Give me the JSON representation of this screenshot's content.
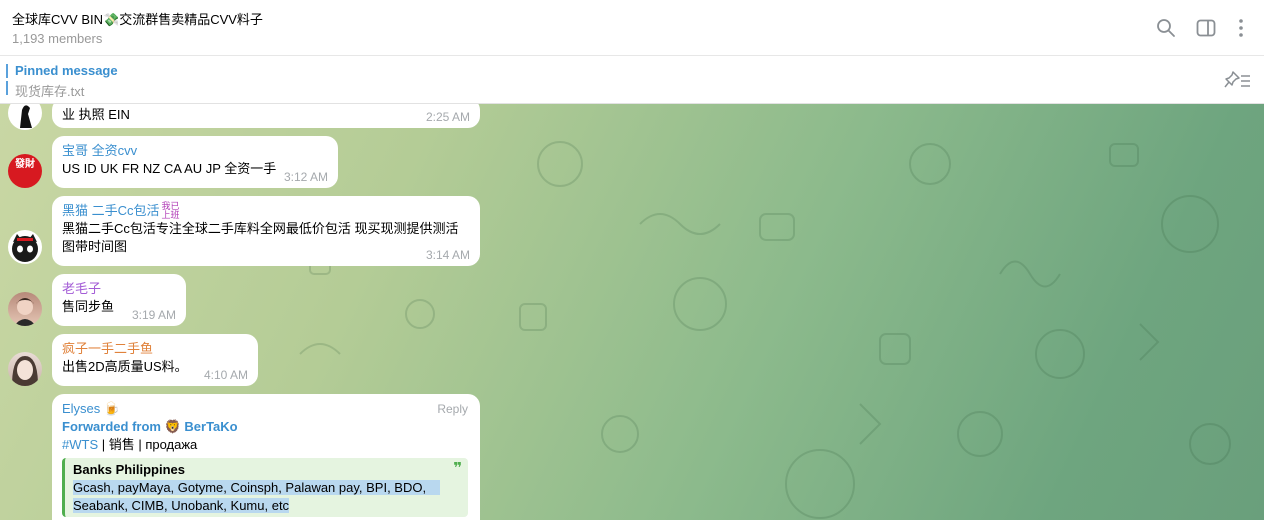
{
  "header": {
    "title": "全球库CVV BIN💸交流群售卖精品CVV料子",
    "members": "1,193 members",
    "icons": [
      "search-icon",
      "sidebar-toggle-icon",
      "more-vertical-icon"
    ]
  },
  "pinned": {
    "title": "Pinned message",
    "text": "现货库存.txt"
  },
  "messages": [
    {
      "text": "业 执照 EIN",
      "time": "2:25 AM"
    },
    {
      "name": "宝哥 全资cvv",
      "name_color": "#3a8fcf",
      "text": "US ID UK FR NZ CA AU JP 全资一手",
      "time": "3:12 AM",
      "avatar_text": "發財"
    },
    {
      "name": "黑猫 二手Cc包活",
      "name_color": "#3a8fcf",
      "tag": "我已上班",
      "text": "黑猫二手Cc包活专注全球二手库料全网最低价包活 现买现测提供测活图带时间图",
      "time": "3:14 AM"
    },
    {
      "name": "老毛子",
      "name_color": "#a35bd6",
      "text": "售同步鱼",
      "time": "3:19 AM"
    },
    {
      "name": "疯子一手二手鱼",
      "name_color": "#e0823b",
      "text": "出售2D高质量US料。",
      "time": "4:10 AM"
    },
    {
      "name": "Elyses 🍺",
      "name_color": "#3a8fcf",
      "reply": "Reply",
      "forwarded_label": "Forwarded from",
      "forwarded_from": "🦁 BerTaKo",
      "hashtag": "#WTS",
      "tagline": " | 销售 | продажа",
      "quote_title": "Banks Philippines",
      "quote_line1": "Gcash, payMaya, Gotyme, Coinsph, Palawan pay, BPI, BDO,",
      "quote_line2": "Seabank, CIMB, Unobank, Kumu, etc"
    }
  ],
  "colors": {
    "link": "#3a8fcf",
    "quote_accent": "#4fae4e"
  }
}
